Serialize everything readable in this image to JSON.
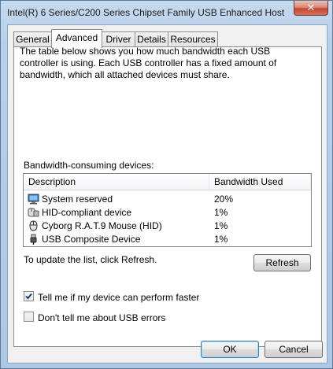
{
  "window": {
    "title": "Intel(R) 6 Series/C200 Series Chipset Family USB Enhanced Host C...",
    "close_glyph": "✕"
  },
  "tabs": [
    {
      "label": "General",
      "active": false
    },
    {
      "label": "Advanced",
      "active": true
    },
    {
      "label": "Driver",
      "active": false
    },
    {
      "label": "Details",
      "active": false
    },
    {
      "label": "Resources",
      "active": false
    }
  ],
  "advanced": {
    "description": "The table below shows you how much bandwidth each USB controller is using. Each USB controller has a fixed amount of bandwidth, which all attached devices must share.",
    "group_label": "Bandwidth-consuming devices:",
    "columns": [
      "Description",
      "Bandwidth Used"
    ],
    "devices": [
      {
        "name": "System reserved",
        "bandwidth": "20%",
        "icon": "computer-icon"
      },
      {
        "name": "HID-compliant device",
        "bandwidth": "1%",
        "icon": "hid-device-icon"
      },
      {
        "name": "Cyborg R.A.T.9 Mouse (HID)",
        "bandwidth": "1%",
        "icon": "mouse-icon"
      },
      {
        "name": "USB Composite Device",
        "bandwidth": "1%",
        "icon": "usb-plug-icon"
      }
    ],
    "refresh_hint": "To update the list, click Refresh.",
    "refresh_label": "Refresh",
    "checkbox_faster": {
      "label": "Tell me if my device can perform faster",
      "checked": true
    },
    "checkbox_errors": {
      "label": "Don't tell me about USB errors",
      "checked": false
    }
  },
  "footer": {
    "ok_label": "OK",
    "cancel_label": "Cancel"
  }
}
